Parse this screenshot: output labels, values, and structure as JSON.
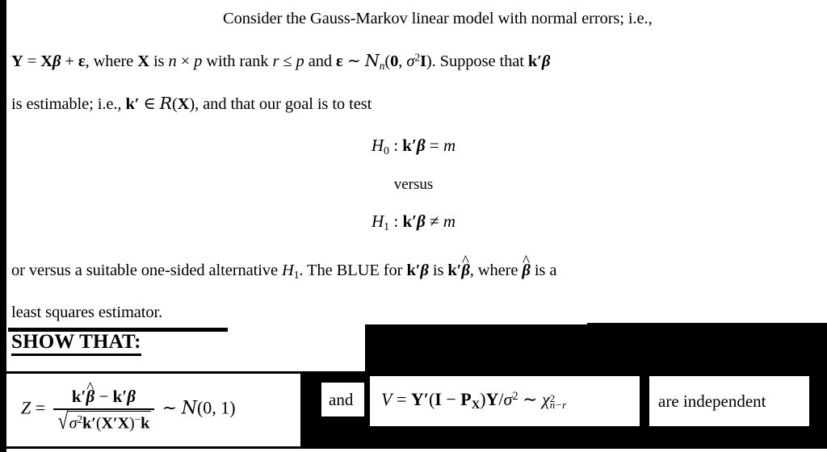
{
  "document": {
    "type": "statistics-lecture-slide",
    "subject": "Gauss-Markov linear model hypothesis test",
    "background_color": "#ffffff",
    "overlay_color": "#000000"
  },
  "prose": {
    "line1": "Consider the Gauss-Markov linear model with normal errors; i.e.,",
    "line2_plain": "Y = Xβ + ε, where X is n × p with rank r ≤ p and ε ~ N_n(0, σ²I). Suppose that k'β",
    "line3_plain": "is estimable; i.e., k' ∈ R(X), and that our goal is to test",
    "line4_plain": "or versus a suitable one-sided alternative H₁. The BLUE for k'β is k'β̂, where β̂ is a",
    "line5_plain": "least squares estimator.",
    "line2": {
      "seg1": "Y",
      "seg2": " = ",
      "seg3": "X",
      "seg4": "β",
      "seg5": " + ",
      "seg6": "ε",
      "seg7": ", where ",
      "seg8": "X",
      "seg9": " is ",
      "seg10": "n",
      "seg11": " × ",
      "seg12": "p",
      "seg13": " with rank ",
      "seg14": "r",
      "seg15": " ≤ ",
      "seg16": "p",
      "seg17": " and ",
      "seg18": "ε",
      "seg19": " ∼ ",
      "seg20": "N",
      "seg21": "n",
      "seg22": "(",
      "seg23": "0",
      "seg24": ", ",
      "seg25": "σ",
      "seg26": "2",
      "seg27": "I",
      "seg28": "). Suppose that ",
      "seg29": "k",
      "seg30": "′",
      "seg31": "β"
    },
    "line3": {
      "seg1": "is estimable; i.e., ",
      "seg2": "k",
      "seg3": "′",
      "seg4": " ∈ ",
      "seg5": "R",
      "seg6": "(",
      "seg7": "X",
      "seg8": "), and that our goal is to test"
    },
    "line4": {
      "seg1": "or versus a suitable one-sided alternative ",
      "seg2": "H",
      "seg3": "1",
      "seg4": ".  The BLUE for ",
      "seg5": "k",
      "seg6": "′",
      "seg7": "β",
      "seg8": " is ",
      "seg9": "k",
      "seg10": "′",
      "seg11": "β",
      "seg12": ", where ",
      "seg13": "β",
      "seg14": " is a"
    },
    "line5": "least squares estimator."
  },
  "hypotheses": {
    "null": {
      "symbol": "H",
      "subscript": "0",
      "colon": " : ",
      "lhs_k": "k",
      "lhs_prime": "′",
      "lhs_beta": "β",
      "relation": " = ",
      "rhs": "m",
      "plain": "H₀ : k'β = m"
    },
    "versus_label": "versus",
    "alternative": {
      "symbol": "H",
      "subscript": "1",
      "colon": " : ",
      "lhs_k": "k",
      "lhs_prime": "′",
      "lhs_beta": "β",
      "relation": " ≠ ",
      "rhs": "m",
      "plain": "H₁ : k'β ≠ m"
    }
  },
  "show_that": {
    "label": "SHOW THAT:",
    "underlined": true,
    "bold": true
  },
  "formulas": {
    "z_statistic": {
      "plain": "Z = (k'β̂ − k'β) / sqrt(σ²k'(X'X)⁻k) ~ N(0,1)",
      "lead_var": "Z",
      "equals": " = ",
      "numerator": {
        "k1": "k",
        "prime1": "′",
        "beta_hat": "β",
        "minus": " − ",
        "k2": "k",
        "prime2": "′",
        "beta": "β"
      },
      "denominator": {
        "radical": "√",
        "sigma": "σ",
        "sigma_exp": "2",
        "k": "k",
        "prime": "′",
        "open": "(",
        "X1": "X",
        "Xprime": "′",
        "X2": "X",
        "close": ")",
        "gen_inverse": "−",
        "k_end": "k"
      },
      "distributed_as": " ∼ ",
      "distribution_symbol": "N",
      "distribution_params": "(0, 1)"
    },
    "conjunction": "and",
    "v_statistic": {
      "plain": "V = Y'(I − P_X)Y/σ² ~ χ²_{n−r}",
      "lead_var": "V",
      "equals": " = ",
      "Y1": "Y",
      "Yprime": "′",
      "open": "(",
      "I": "I",
      "minus": " − ",
      "P": "P",
      "P_sub": "X",
      "close": ")",
      "Y2": "Y",
      "slash": "/",
      "sigma": "σ",
      "sigma_exp": "2",
      "distributed_as": " ∼ ",
      "chi": "χ",
      "chi_sup": "2",
      "chi_sub": "n−r"
    },
    "conclusion": "are independent"
  }
}
